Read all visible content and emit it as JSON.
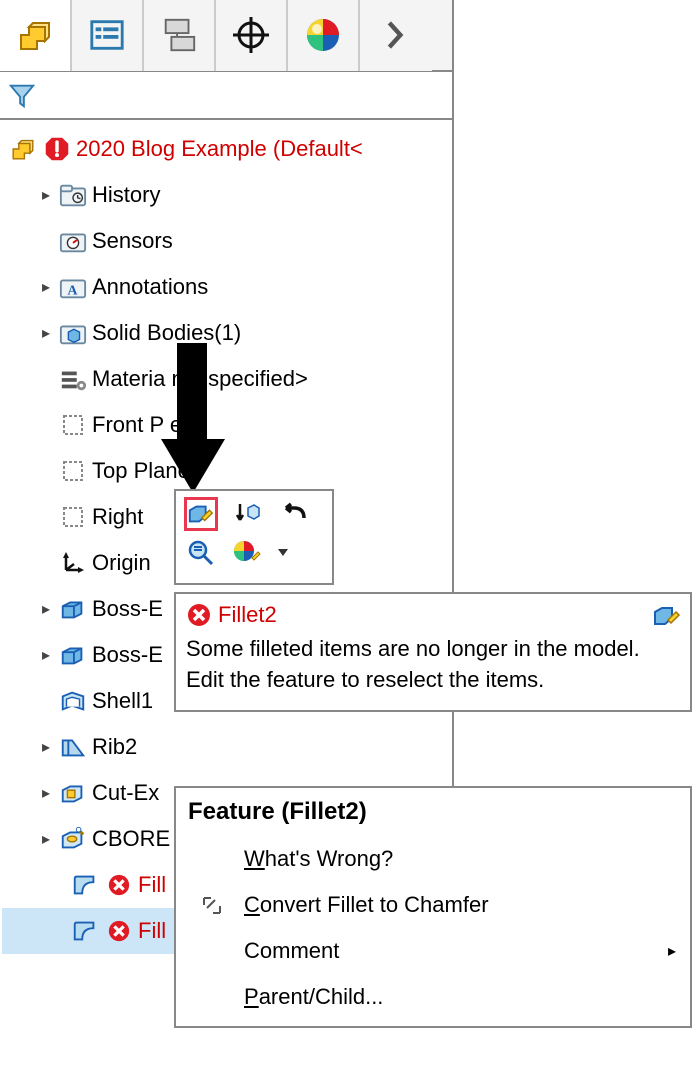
{
  "root": {
    "title": "2020 Blog Example  (Default<"
  },
  "tree": {
    "history": "History",
    "sensors": "Sensors",
    "annotations": "Annotations",
    "solid_bodies": "Solid Bodies(1)",
    "material": "Materia    not specified>",
    "front_plane": "Front P    e",
    "top_plane": "Top Plane",
    "right_plane": "Right",
    "origin": "Origin",
    "boss1": "Boss-E",
    "boss2": "Boss-E",
    "shell1": "Shell1",
    "rib2": "Rib2",
    "cutex": "Cut-Ex",
    "cbore": "CBORE",
    "fillet1": "Fill",
    "fillet2": "Fill"
  },
  "error": {
    "title": "Fillet2",
    "message": "Some filleted items are no longer in the model. Edit the feature to reselect the items."
  },
  "menu": {
    "title": "Feature (Fillet2)",
    "whats_wrong": "What's Wrong?",
    "convert": "Convert Fillet to Chamfer",
    "comment": "Comment",
    "parent_child": "Parent/Child..."
  }
}
